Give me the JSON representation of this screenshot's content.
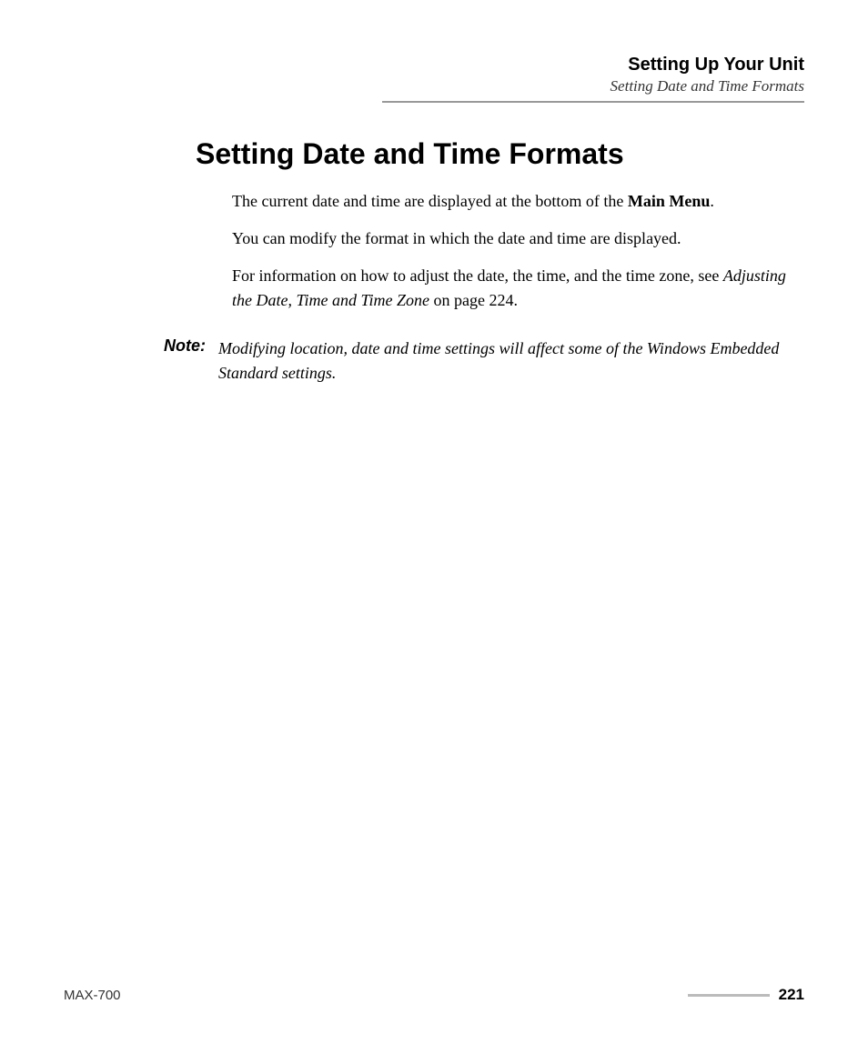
{
  "header": {
    "chapter": "Setting Up Your Unit",
    "section": "Setting Date and Time Formats"
  },
  "section_heading": "Setting Date and Time Formats",
  "paragraphs": {
    "p1_pre": "The current date and time are displayed at the bottom of the ",
    "p1_bold": "Main Menu",
    "p1_post": ".",
    "p2": "You can modify the format in which the date and time are displayed.",
    "p3_pre": "For information on how to adjust the date, the time, and the time zone, see ",
    "p3_italic": "Adjusting the Date, Time and Time Zone",
    "p3_post": " on page 224."
  },
  "note": {
    "label": "Note:",
    "text": "Modifying location, date and time settings will affect some of the Windows Embedded Standard settings."
  },
  "footer": {
    "model": "MAX-700",
    "page": "221"
  }
}
